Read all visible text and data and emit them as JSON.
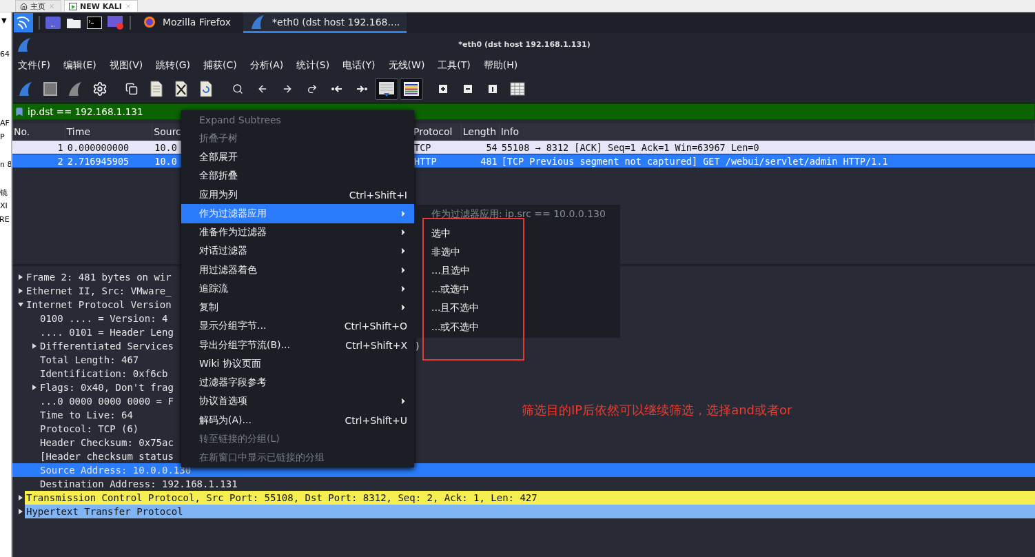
{
  "host_tabs": [
    {
      "label": "主页",
      "kind": "home",
      "selected": false
    },
    {
      "label": "NEW KALI",
      "kind": "vm",
      "selected": true
    }
  ],
  "host_strip": {
    "dropdown": "▼",
    "fragments": [
      "64",
      "AF",
      "P",
      "n 8",
      "镜",
      "XI",
      "RE"
    ]
  },
  "taskbar": {
    "launchers": [
      {
        "kind": "desktop"
      },
      {
        "kind": "files"
      },
      {
        "kind": "terminal"
      },
      {
        "kind": "recorder"
      }
    ],
    "tasks": [
      {
        "label": "Mozilla Firefox",
        "kind": "browser",
        "selected": false
      },
      {
        "label": "*eth0 (dst host 192.168....",
        "kind": "wireshark",
        "selected": true
      }
    ]
  },
  "window": {
    "title": "*eth0 (dst host 192.168.1.131)"
  },
  "menubar": [
    "文件(F)",
    "编辑(E)",
    "视图(V)",
    "跳转(G)",
    "捕获(C)",
    "分析(A)",
    "统计(S)",
    "电话(Y)",
    "无线(W)",
    "工具(T)",
    "帮助(H)"
  ],
  "toolbar": [
    {
      "kind": "start",
      "pressed": false
    },
    {
      "kind": "stop",
      "pressed": false
    },
    {
      "kind": "restart",
      "pressed": false
    },
    {
      "kind": "options",
      "pressed": false
    },
    {
      "kind": "open",
      "pressed": false
    },
    {
      "kind": "file",
      "pressed": false
    },
    {
      "kind": "close",
      "pressed": false
    },
    {
      "kind": "reload",
      "pressed": false
    },
    {
      "kind": "search",
      "pressed": false
    },
    {
      "kind": "back",
      "pressed": false
    },
    {
      "kind": "forward",
      "pressed": false
    },
    {
      "kind": "goto",
      "pressed": false
    },
    {
      "kind": "first",
      "pressed": false
    },
    {
      "kind": "last",
      "pressed": false
    },
    {
      "kind": "autoscroll",
      "pressed": true
    },
    {
      "kind": "colorize",
      "pressed": true
    },
    {
      "kind": "zoomin",
      "pressed": false
    },
    {
      "kind": "zoomout",
      "pressed": false
    },
    {
      "kind": "normal",
      "pressed": false
    },
    {
      "kind": "resize",
      "pressed": false
    }
  ],
  "filter": {
    "value": "ip.dst == 192.168.1.131"
  },
  "packet_list": {
    "columns": [
      "No.",
      "Time",
      "Sourc",
      "Protocol",
      "Length",
      "Info"
    ],
    "rows": [
      {
        "no": "1",
        "time": "0.000000000",
        "source": "10.0",
        "protocol": "TCP",
        "length": "54",
        "info": "55108 → 8312 [ACK] Seq=1 Ack=1 Win=63967 Len=0",
        "selected": false
      },
      {
        "no": "2",
        "time": "2.716945905",
        "source": "10.0",
        "protocol": "HTTP",
        "length": "481",
        "info": "[TCP Previous segment not captured] GET /webui/servlet/admin HTTP/1.1",
        "selected": true
      }
    ]
  },
  "details": [
    {
      "label": "Frame 2: 481 bytes on wir",
      "expanded": false,
      "selected": false
    },
    {
      "label": "Ethernet II, Src: VMware_",
      "expanded": false,
      "selected": false
    },
    {
      "label": "Internet Protocol Version",
      "expanded": true,
      "selected": false,
      "children": [
        {
          "label": "0100 .... = Version: 4",
          "selected": false
        },
        {
          "label": ".... 0101 = Header Leng",
          "selected": false
        },
        {
          "label": "Differentiated Services",
          "tail": ")",
          "expanded": false,
          "selected": false
        },
        {
          "label": "Total Length: 467",
          "selected": false
        },
        {
          "label": "Identification: 0xf6cb",
          "selected": false
        },
        {
          "label": "Flags: 0x40, Don't frag",
          "expanded": false,
          "selected": false
        },
        {
          "label": "...0 0000 0000 0000 = F",
          "selected": false
        },
        {
          "label": "Time to Live: 64",
          "selected": false
        },
        {
          "label": "Protocol: TCP (6)",
          "selected": false
        },
        {
          "label": "Header Checksum: 0x75ac",
          "selected": false
        },
        {
          "label": "[Header checksum status",
          "selected": false
        },
        {
          "label": "Source Address: 10.0.0.130",
          "selected": true
        },
        {
          "label": "Destination Address: 192.168.1.131",
          "selected": false
        }
      ]
    },
    {
      "label": "Transmission Control Protocol, Src Port: 55108, Dst Port: 8312, Seq: 2, Ack: 1, Len: 427",
      "expanded": false,
      "selected": false,
      "color": "#f7ef52"
    },
    {
      "label": "Hypertext Transfer Protocol",
      "expanded": false,
      "selected": false,
      "color": "#7fb5f5"
    }
  ],
  "context_menu": [
    {
      "label": "Expand Subtrees",
      "submenu": false,
      "disabled": true,
      "selected": false
    },
    {
      "label": "折叠子树",
      "submenu": false,
      "disabled": true,
      "selected": false
    },
    {
      "label": "全部展开",
      "submenu": false,
      "disabled": false,
      "selected": false
    },
    {
      "label": "全部折叠",
      "submenu": false,
      "disabled": false,
      "selected": false
    },
    {
      "label": "应用为列",
      "shortcut": "Ctrl+Shift+I",
      "submenu": false,
      "disabled": false,
      "selected": false
    },
    {
      "label": "作为过滤器应用",
      "submenu": true,
      "disabled": false,
      "selected": true
    },
    {
      "label": "准备作为过滤器",
      "submenu": true,
      "disabled": false,
      "selected": false
    },
    {
      "label": "对话过滤器",
      "submenu": true,
      "disabled": false,
      "selected": false
    },
    {
      "label": "用过滤器着色",
      "submenu": true,
      "disabled": false,
      "selected": false
    },
    {
      "label": "追踪流",
      "submenu": true,
      "disabled": false,
      "selected": false
    },
    {
      "label": "复制",
      "submenu": true,
      "disabled": false,
      "selected": false
    },
    {
      "label": "显示分组字节...",
      "shortcut": "Ctrl+Shift+O",
      "submenu": false,
      "disabled": false,
      "selected": false
    },
    {
      "label": "导出分组字节流(B)...",
      "shortcut": "Ctrl+Shift+X",
      "submenu": false,
      "disabled": false,
      "selected": false
    },
    {
      "label": "Wiki 协议页面",
      "submenu": false,
      "disabled": false,
      "selected": false
    },
    {
      "label": "过滤器字段参考",
      "submenu": false,
      "disabled": false,
      "selected": false
    },
    {
      "label": "协议首选项",
      "submenu": true,
      "disabled": false,
      "selected": false
    },
    {
      "label": "解码为(A)...",
      "shortcut": "Ctrl+Shift+U",
      "submenu": false,
      "disabled": false,
      "selected": false
    },
    {
      "label": "转至链接的分组(L)",
      "submenu": false,
      "disabled": true,
      "selected": false
    },
    {
      "label": "在新窗口中显示已链接的分组",
      "submenu": false,
      "disabled": true,
      "selected": false
    }
  ],
  "submenu": {
    "title": "作为过滤器应用: ip.src == 10.0.0.130",
    "items": [
      "选中",
      "非选中",
      "…且选中",
      "...或选中",
      "...且不选中",
      "...或不选中"
    ]
  },
  "annotation": "筛选目的IP后依然可以继续筛选，选择and或者or"
}
